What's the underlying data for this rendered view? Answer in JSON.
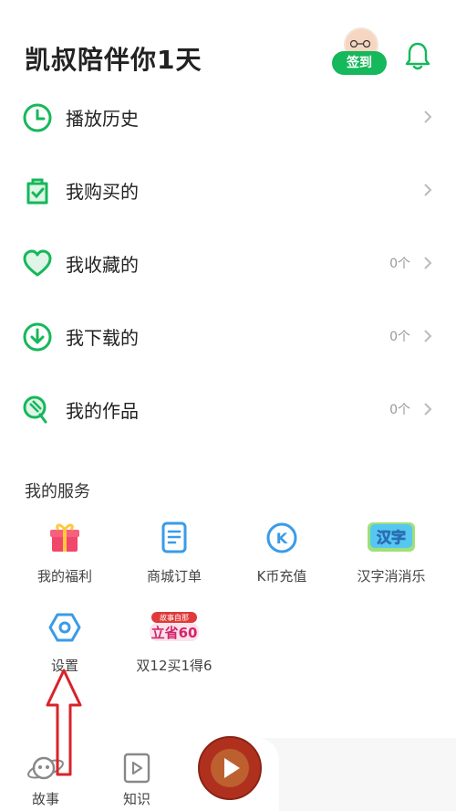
{
  "header": {
    "title": "凯叔陪伴你1天",
    "checkin_label": "签到"
  },
  "menu": [
    {
      "label": "播放历史",
      "count": "",
      "icon": "clock-icon"
    },
    {
      "label": "我购买的",
      "count": "",
      "icon": "purchase-icon"
    },
    {
      "label": "我收藏的",
      "count": "0个",
      "icon": "heart-icon"
    },
    {
      "label": "我下载的",
      "count": "0个",
      "icon": "download-icon"
    },
    {
      "label": "我的作品",
      "count": "0个",
      "icon": "works-icon"
    }
  ],
  "services": {
    "title": "我的服务",
    "items": [
      {
        "label": "我的福利",
        "icon": "gift-icon"
      },
      {
        "label": "商城订单",
        "icon": "order-icon"
      },
      {
        "label": "K币充值",
        "icon": "k-coin-icon",
        "badge": "K"
      },
      {
        "label": "汉字消消乐",
        "icon": "hanzi-game-icon",
        "badge": "汉字"
      },
      {
        "label": "设置",
        "icon": "settings-icon"
      },
      {
        "label": "双12买1得6",
        "icon": "promo-icon",
        "badge_top": "故事自那",
        "badge_main": "立省60"
      }
    ]
  },
  "tabbar": {
    "tabs": [
      {
        "label": "故事",
        "icon": "planet-icon"
      },
      {
        "label": "知识",
        "icon": "video-icon"
      }
    ]
  },
  "colors": {
    "accent": "#15b85a",
    "text_primary": "#222222",
    "text_secondary": "#999999",
    "annotation_arrow": "#d8232a"
  }
}
